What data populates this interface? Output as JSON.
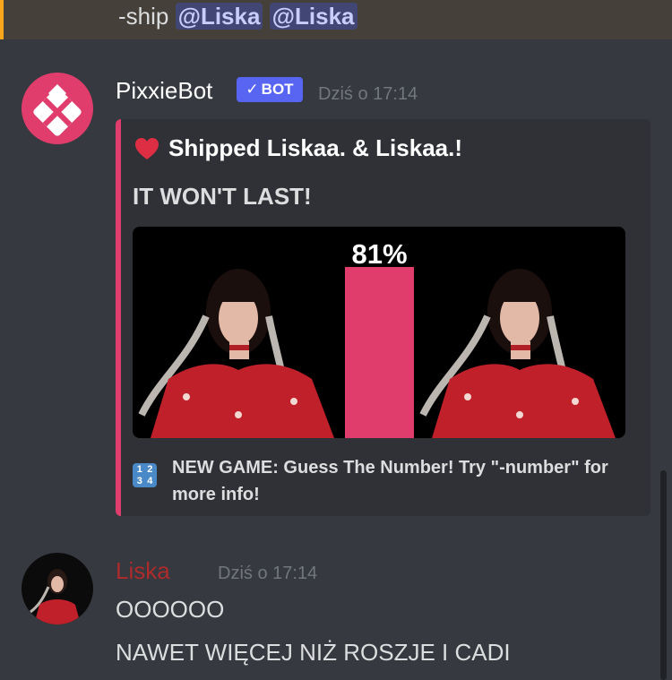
{
  "top_message": {
    "prefix": "-ship",
    "mentions": [
      "@Liska",
      "@Liska"
    ]
  },
  "bot_message": {
    "author": "PixxieBot",
    "badge": "BOT",
    "timestamp": "Dziś o 17:14",
    "embed": {
      "accent_color": "#e13d6c",
      "title": "Shipped Liskaa. & Liskaa.!",
      "description": "IT WON'T LAST!",
      "percent_label": "81%",
      "percent_value": 0.81,
      "footer_icon_digits": [
        "1",
        "2",
        "3",
        "4"
      ],
      "footer_text": "NEW GAME: Guess The Number! Try \"-number\" for more info!"
    }
  },
  "user_message": {
    "author": "Liska",
    "author_color": "#ad2b2b",
    "timestamp": "Dziś o 17:14",
    "lines": [
      "OOOOOO",
      "NAWET WIĘCEJ NIŻ ROSZJE I CADI"
    ]
  }
}
